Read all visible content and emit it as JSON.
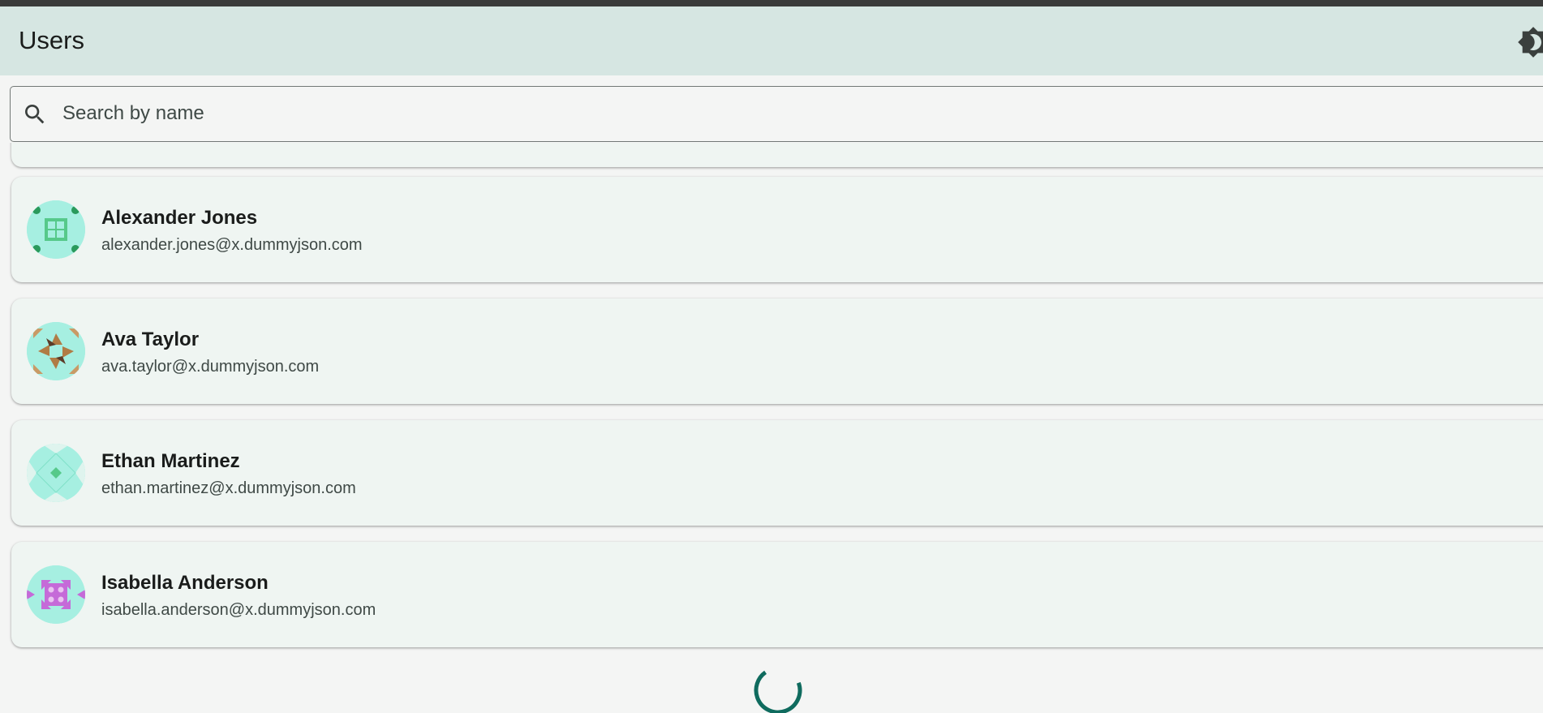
{
  "app_bar": {
    "title": "Users",
    "theme_toggle_icon": "brightness-icon"
  },
  "search": {
    "placeholder": "Search by name",
    "value": "",
    "icon": "search-icon"
  },
  "users": [
    {
      "name": "Alexander Jones",
      "email": "alexander.jones@x.dummyjson.com"
    },
    {
      "name": "Ava Taylor",
      "email": "ava.taylor@x.dummyjson.com"
    },
    {
      "name": "Ethan Martinez",
      "email": "ethan.martinez@x.dummyjson.com"
    },
    {
      "name": "Isabella Anderson",
      "email": "isabella.anderson@x.dummyjson.com"
    }
  ],
  "loading_indicator": "progress-spinner",
  "colors": {
    "app_bar_bg": "#d6e6e2",
    "card_bg": "#eff5f2",
    "spinner": "#0f6b5e",
    "avatar_bg": "#a6efe1"
  }
}
